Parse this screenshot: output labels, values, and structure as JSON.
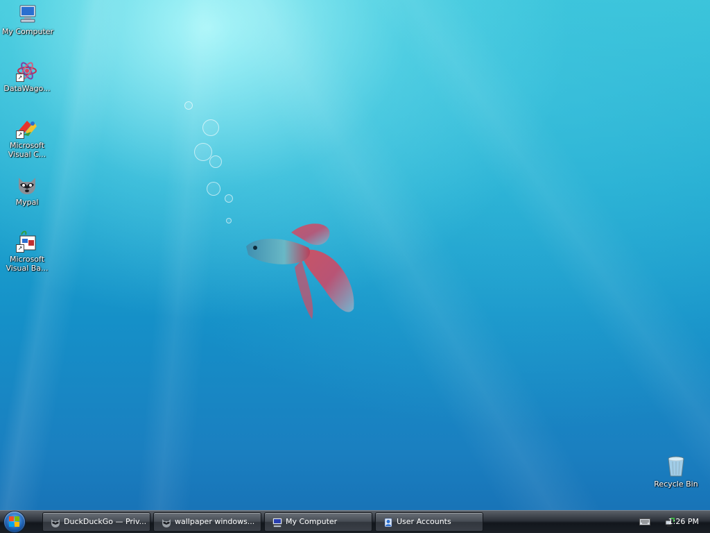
{
  "desktop": {
    "icons": [
      {
        "label": "My Computer",
        "icon": "computer-icon"
      },
      {
        "label": "DataWago...",
        "icon": "datawagon-icon"
      },
      {
        "label": "Microsoft Visual C...",
        "icon": "visual-c-icon"
      },
      {
        "label": "Mypal",
        "icon": "mypal-icon"
      },
      {
        "label": "Microsoft Visual Ba...",
        "icon": "visual-basic-icon"
      }
    ],
    "recycle_bin": {
      "label": "Recycle Bin",
      "icon": "recycle-bin-icon"
    }
  },
  "taskbar": {
    "buttons": [
      {
        "label": "DuckDuckGo — Priv...",
        "icon": "mypal-icon"
      },
      {
        "label": "wallpaper windows...",
        "icon": "mypal-icon"
      },
      {
        "label": "My Computer",
        "icon": "computer-icon"
      },
      {
        "label": "User Accounts",
        "icon": "user-accounts-icon"
      }
    ],
    "clock": "1:26 PM",
    "tray_icons": [
      "keyboard-icon",
      "network-icon"
    ]
  },
  "colors": {
    "taskbar": "#1b2026",
    "desktop_top": "#37c3d8",
    "desktop_bottom": "#176fb4"
  }
}
